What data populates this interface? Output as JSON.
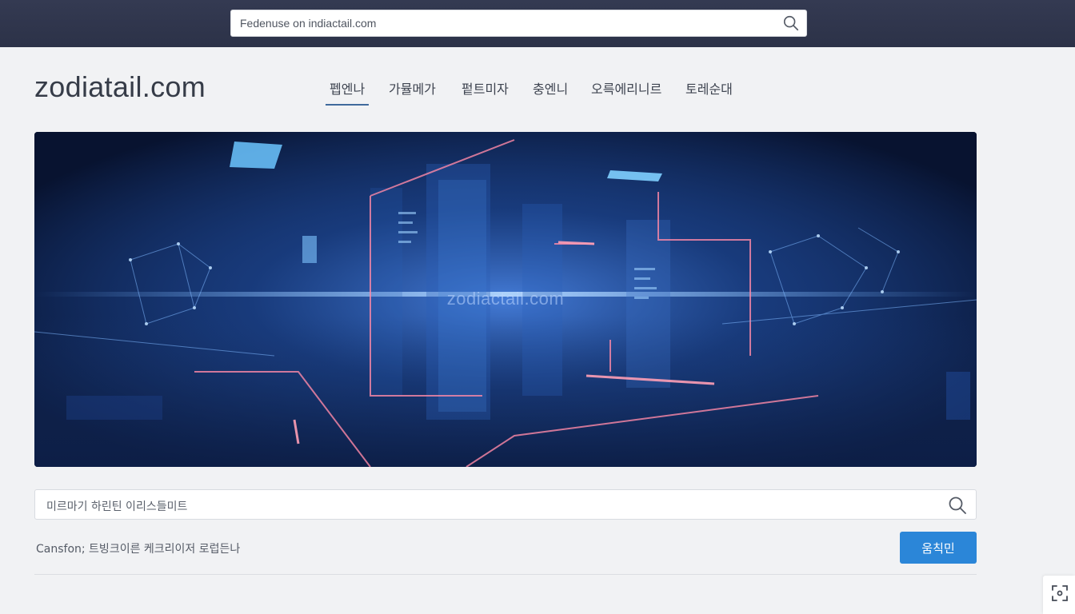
{
  "browser": {
    "url": "Fedenuse on indiactail.com"
  },
  "header": {
    "site_title": "zodiatail.com"
  },
  "nav": {
    "items": [
      "펩엔나",
      "가뮬메가",
      "펕트미자",
      "충엔니",
      "오륵에리니르",
      "토레순대"
    ],
    "active_index": 0
  },
  "hero": {
    "watermark": "zodiactail.com"
  },
  "search": {
    "placeholder": "미르마기 하린틴 이리스들미트"
  },
  "footer": {
    "caption": "Cansfon; 트빙크이른 케크리이저 로럽든나",
    "confirm_label": "움칙민"
  },
  "colors": {
    "topbar": "#2f3550",
    "accent": "#2b86d8",
    "nav_underline": "#3f6a9c"
  },
  "icons": {
    "url_search": "search-icon",
    "field_search": "search-icon",
    "corner": "expand-icon"
  }
}
